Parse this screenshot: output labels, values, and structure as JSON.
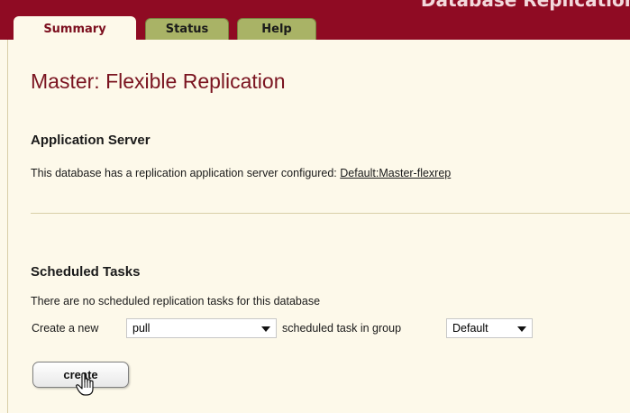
{
  "header": {
    "title": "Database Replication"
  },
  "tabs": [
    {
      "label": "Summary",
      "active": true
    },
    {
      "label": "Status",
      "active": false
    },
    {
      "label": "Help",
      "active": false
    }
  ],
  "main": {
    "title": "Master: Flexible Replication",
    "app_server": {
      "heading": "Application Server",
      "text": "This database has a replication application server configured:",
      "link": "Default:Master-flexrep"
    },
    "scheduled": {
      "heading": "Scheduled Tasks",
      "empty_text": "There are no scheduled replication tasks for this database",
      "create_prefix": "Create a new",
      "task_type_selected": "pull",
      "create_middle": "scheduled task in group",
      "group_selected": "Default",
      "create_button": "create"
    }
  },
  "colors": {
    "header": "#8f0b23",
    "background": "#fdf9ea",
    "tab_inactive": "#a9b366",
    "title": "#7a1420"
  },
  "icons": {
    "cursor": "hand-pointer-icon",
    "dropdown": "chevron-down-icon"
  }
}
